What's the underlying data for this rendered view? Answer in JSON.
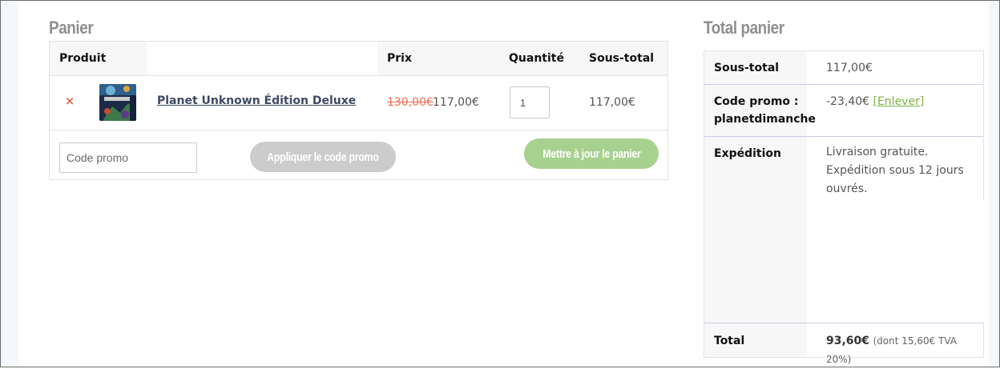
{
  "cart": {
    "title": "Panier",
    "headers": {
      "product": "Produit",
      "price": "Prix",
      "quantity": "Quantité",
      "subtotal": "Sous-total"
    },
    "item": {
      "remove_symbol": "×",
      "name": "Planet Unknown Édition Deluxe",
      "thumbnail_icon": "board-game-box-thumbnail",
      "price_old": "130,00€",
      "price_new": "117,00€",
      "quantity": "1",
      "subtotal": "117,00€"
    },
    "promo_placeholder": "Code promo",
    "apply_button": "Appliquer le code promo",
    "update_button": "Mettre à jour le panier"
  },
  "totals": {
    "title": "Total panier",
    "subtotal_label": "Sous-total",
    "subtotal_value": "117,00€",
    "coupon_label_line1": "Code promo :",
    "coupon_label_line2": "planetdimanche",
    "coupon_value": "-23,40€",
    "coupon_remove": "[Enlever]",
    "shipping_label": "Expédition",
    "shipping_line1": "Livraison gratuite.",
    "shipping_line2": "Expédition sous 12 jours",
    "shipping_line3": "ouvrés.",
    "total_label": "Total",
    "total_value": "93,60€",
    "tax_note": "(dont 15,60€ TVA 20%)"
  },
  "colors": {
    "remove": "#e2401c",
    "apply_button_bg": "#cccccc",
    "update_button_bg": "#a7d18f",
    "link_green": "#7cb342",
    "heading_gray": "#8f8f8f"
  }
}
